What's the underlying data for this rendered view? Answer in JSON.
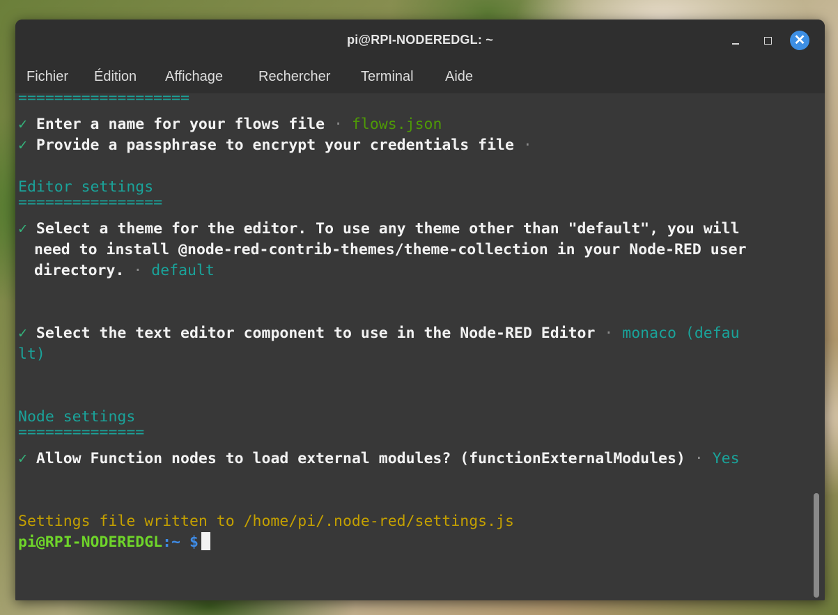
{
  "window": {
    "title": "pi@RPI-NODEREDGL: ~",
    "controls": {
      "minimize": "–",
      "close": "✕"
    }
  },
  "menu": [
    "Fichier",
    "Édition",
    "Affichage",
    "Rechercher",
    "Terminal",
    "Aide"
  ],
  "terminal": {
    "underline_1": "===================",
    "q_flows_label": " Enter a name for your flows file ",
    "q_flows_value": "flows.json",
    "q_pass_label": " Provide a passphrase to encrypt your credentials file ",
    "editor_heading": "Editor settings",
    "editor_underline": "================",
    "q_theme_line1": " Select a theme for the editor. To use any theme other than \"default\", you will",
    "q_theme_line2": " need to install @node-red-contrib-themes/theme-collection in your Node-RED user",
    "q_theme_line3": " directory. ",
    "q_theme_value": "default",
    "q_texteditor_label": " Select the text editor component to use in the Node-RED Editor ",
    "q_texteditor_value_1": "monaco (defau",
    "q_texteditor_value_2": "lt)",
    "node_heading": "Node settings",
    "node_underline": "==============",
    "q_modules_label": " Allow Function nodes to load external modules? (functionExternalModules) ",
    "q_modules_value": "Yes",
    "settings_written": "Settings file written to /home/pi/.node-red/settings.js",
    "prompt_user": "pi@RPI-NODEREDGL",
    "prompt_path": ":~",
    "prompt_symbol": " $",
    "check_glyph": "✓",
    "sep_glyph": "·"
  },
  "colors": {
    "terminal_bg": "#383838",
    "titlebar_bg": "#2f2f2f",
    "teal": "#1aa39a",
    "green": "#4e9a06",
    "yellow": "#c4a000",
    "prompt_user": "#6fd52a",
    "prompt_path": "#3f8ce6",
    "close_button": "#3d8fe4"
  }
}
